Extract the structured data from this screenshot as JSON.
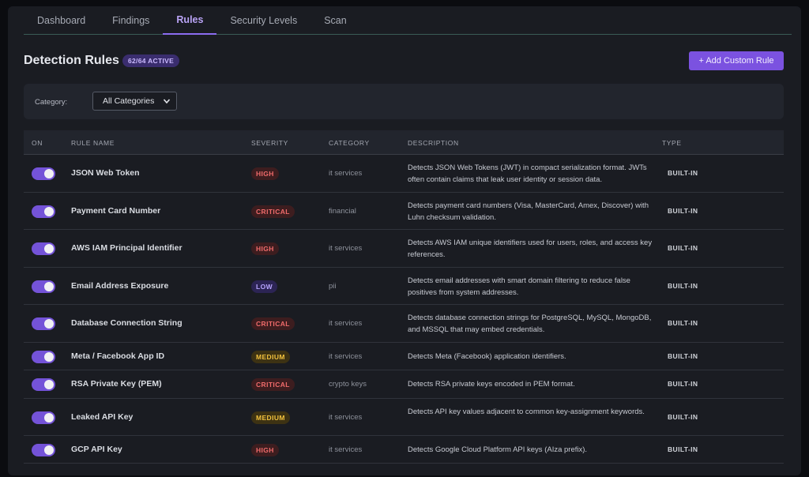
{
  "tabs": [
    {
      "label": "Dashboard"
    },
    {
      "label": "Findings"
    },
    {
      "label": "Rules"
    },
    {
      "label": "Security Levels"
    },
    {
      "label": "Scan"
    }
  ],
  "active_tab": "Rules",
  "header": {
    "title": "Detection Rules",
    "active_badge": "62/64 ACTIVE",
    "add_button": "+ Add Custom Rule"
  },
  "filter": {
    "label": "Category:",
    "selected": "All Categories"
  },
  "table": {
    "columns": {
      "on": "ON",
      "name": "RULE NAME",
      "severity": "SEVERITY",
      "category": "CATEGORY",
      "description": "DESCRIPTION",
      "type": "TYPE"
    },
    "rows": [
      {
        "on": true,
        "name": "JSON Web Token",
        "severity": "HIGH",
        "category": "it services",
        "description": "Detects JSON Web Tokens (JWT) in compact serialization format. JWTs often contain claims that leak user identity or session data.",
        "type": "BUILT-IN"
      },
      {
        "on": true,
        "name": "Payment Card Number",
        "severity": "CRITICAL",
        "category": "financial",
        "description": "Detects payment card numbers (Visa, MasterCard, Amex, Discover) with Luhn checksum validation.",
        "type": "BUILT-IN"
      },
      {
        "on": true,
        "name": "AWS IAM Principal Identifier",
        "severity": "HIGH",
        "category": "it services",
        "description": "Detects AWS IAM unique identifiers used for users, roles, and access key references.",
        "type": "BUILT-IN"
      },
      {
        "on": true,
        "name": "Email Address Exposure",
        "severity": "LOW",
        "category": "pii",
        "description": "Detects email addresses with smart domain filtering to reduce false positives from system addresses.",
        "type": "BUILT-IN"
      },
      {
        "on": true,
        "name": "Database Connection String",
        "severity": "CRITICAL",
        "category": "it services",
        "description": "Detects database connection strings for PostgreSQL, MySQL, MongoDB, and MSSQL that may embed credentials.",
        "type": "BUILT-IN"
      },
      {
        "on": true,
        "name": "Meta / Facebook App ID",
        "severity": "MEDIUM",
        "category": "it services",
        "description": "Detects Meta (Facebook) application identifiers.",
        "type": "BUILT-IN"
      },
      {
        "on": true,
        "name": "RSA Private Key (PEM)",
        "severity": "CRITICAL",
        "category": "crypto keys",
        "description": "Detects RSA private keys encoded in PEM format.",
        "type": "BUILT-IN"
      },
      {
        "on": true,
        "name": "Leaked API Key",
        "severity": "MEDIUM",
        "category": "it services",
        "description": "Detects API key values adjacent to common key-assignment keywords.",
        "type": "BUILT-IN"
      },
      {
        "on": true,
        "name": "GCP API Key",
        "severity": "HIGH",
        "category": "it services",
        "description": "Detects Google Cloud Platform API keys (AIza prefix).",
        "type": "BUILT-IN"
      }
    ]
  },
  "colors": {
    "accent": "#7b52e0",
    "toggle_on": "#7453d8",
    "severity_high": "#f06b6b",
    "severity_critical": "#f06b6b",
    "severity_medium": "#f3c23d",
    "severity_low": "#b8a5ff"
  },
  "icons": {
    "select_chevron": "chevron-down-icon"
  }
}
